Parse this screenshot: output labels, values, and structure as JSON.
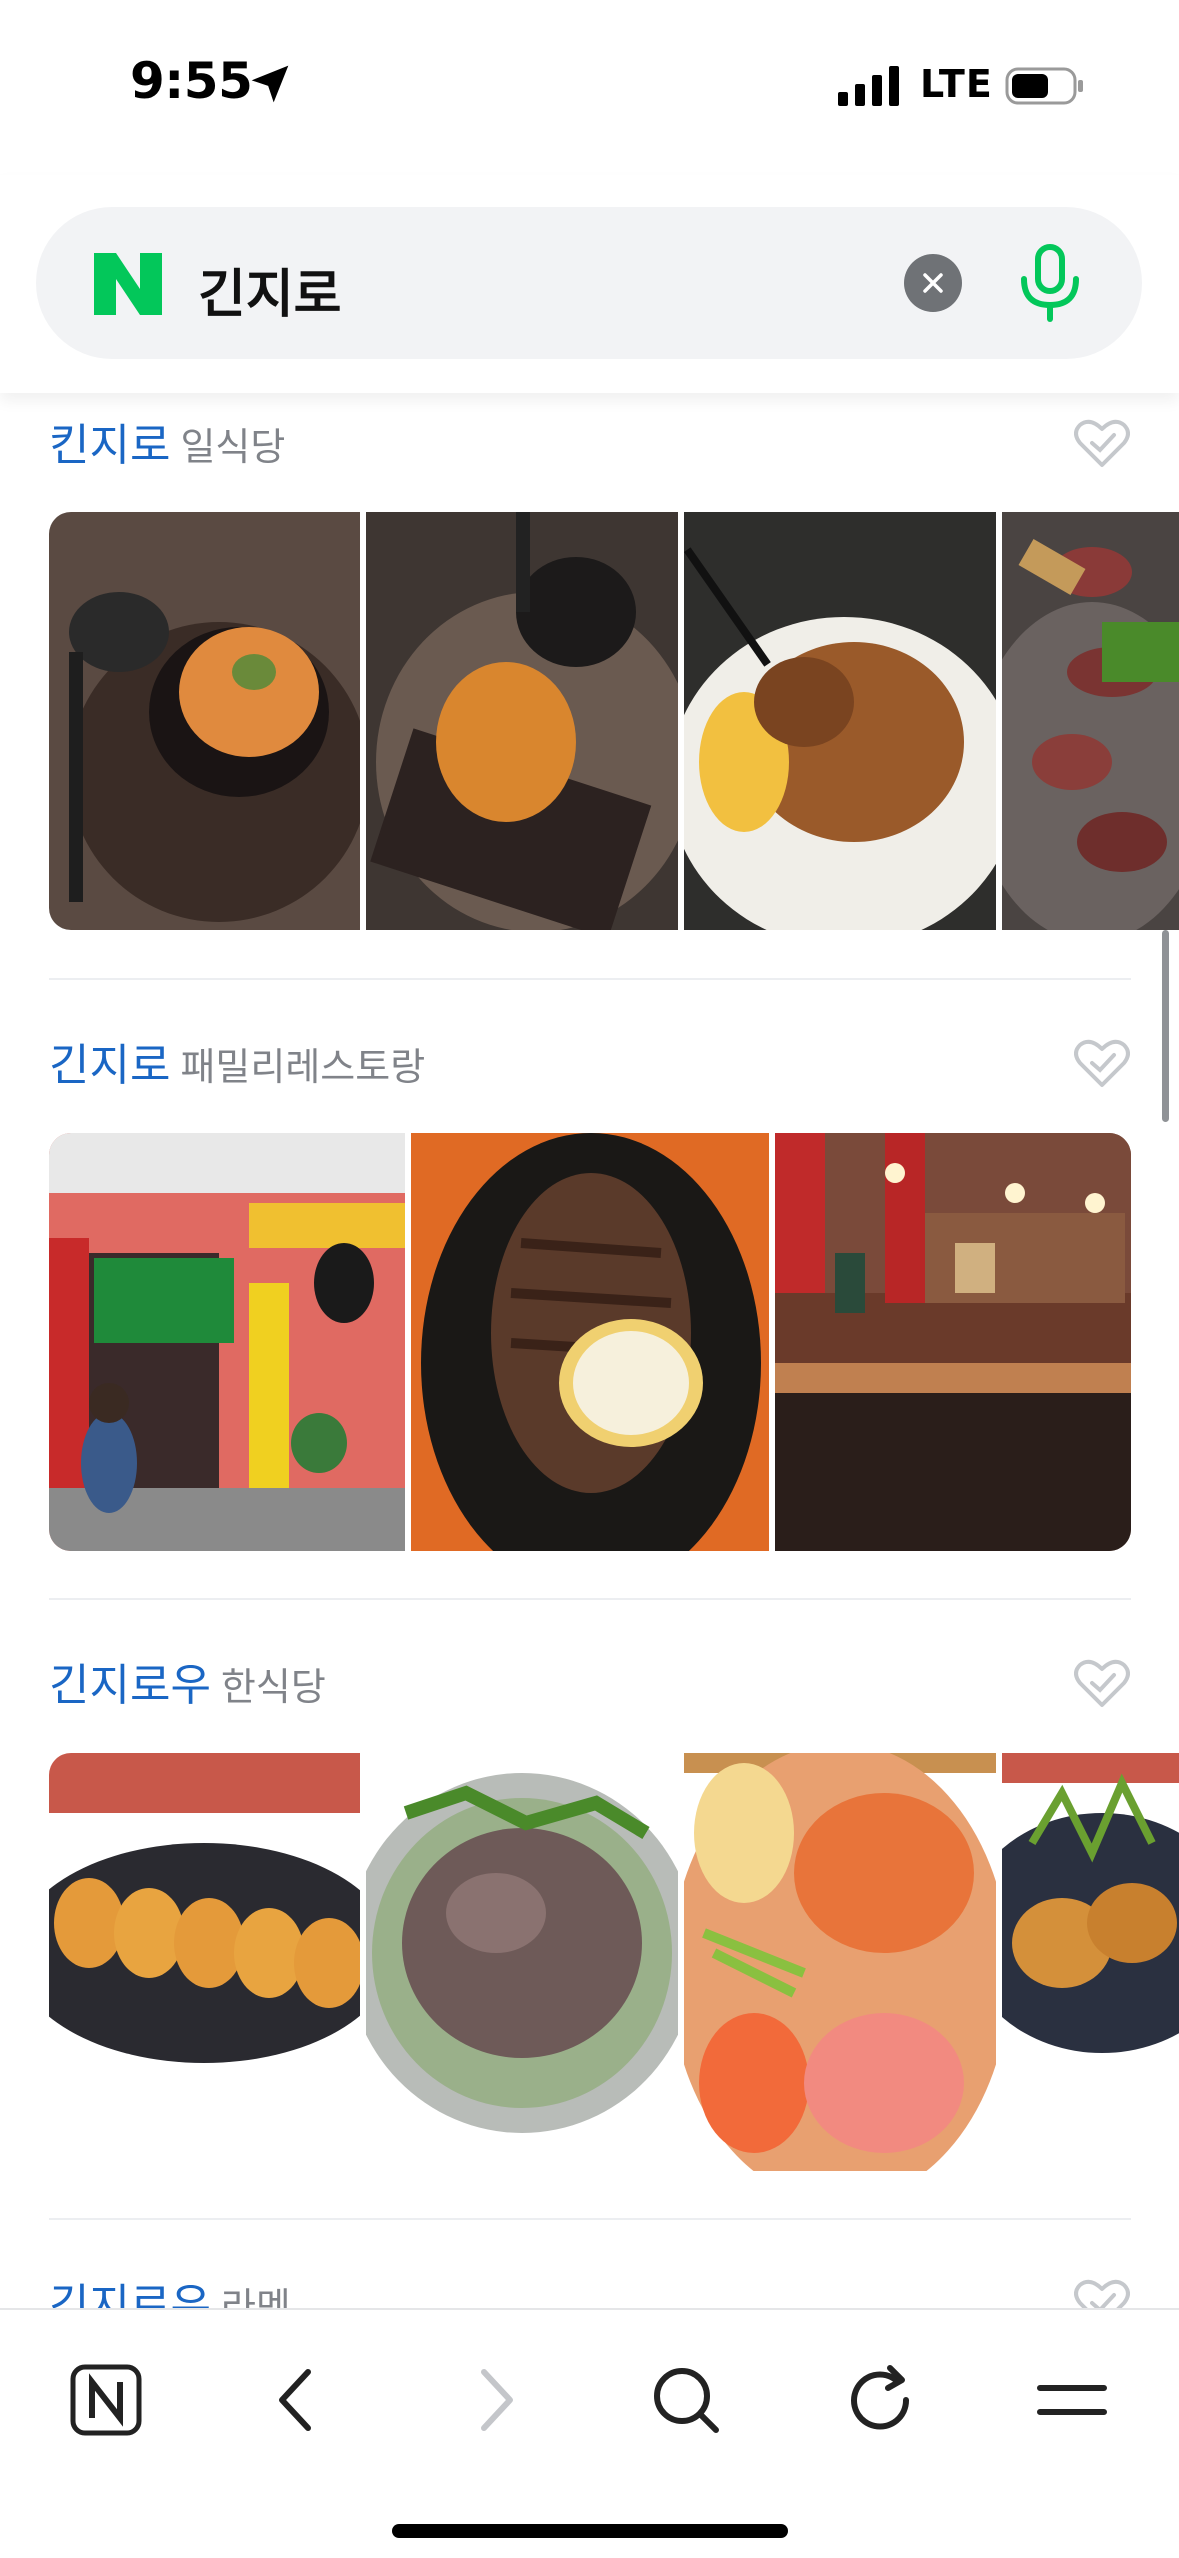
{
  "status_bar": {
    "time": "9:55",
    "network": "LTE"
  },
  "search": {
    "query": "긴지로",
    "colors": {
      "logo": "#03c75a",
      "mic": "#03c75a"
    }
  },
  "results": [
    {
      "name": "킨지로",
      "category": "일식당"
    },
    {
      "name": "긴지로",
      "category": "패밀리레스토랑"
    },
    {
      "name": "긴지로우",
      "category": "한식당"
    },
    {
      "name": "긴지로우",
      "category": "라멘"
    }
  ],
  "toolbar": {
    "items": [
      "naver-home-icon",
      "back-icon",
      "forward-icon",
      "search-icon",
      "refresh-icon",
      "menu-icon"
    ]
  }
}
